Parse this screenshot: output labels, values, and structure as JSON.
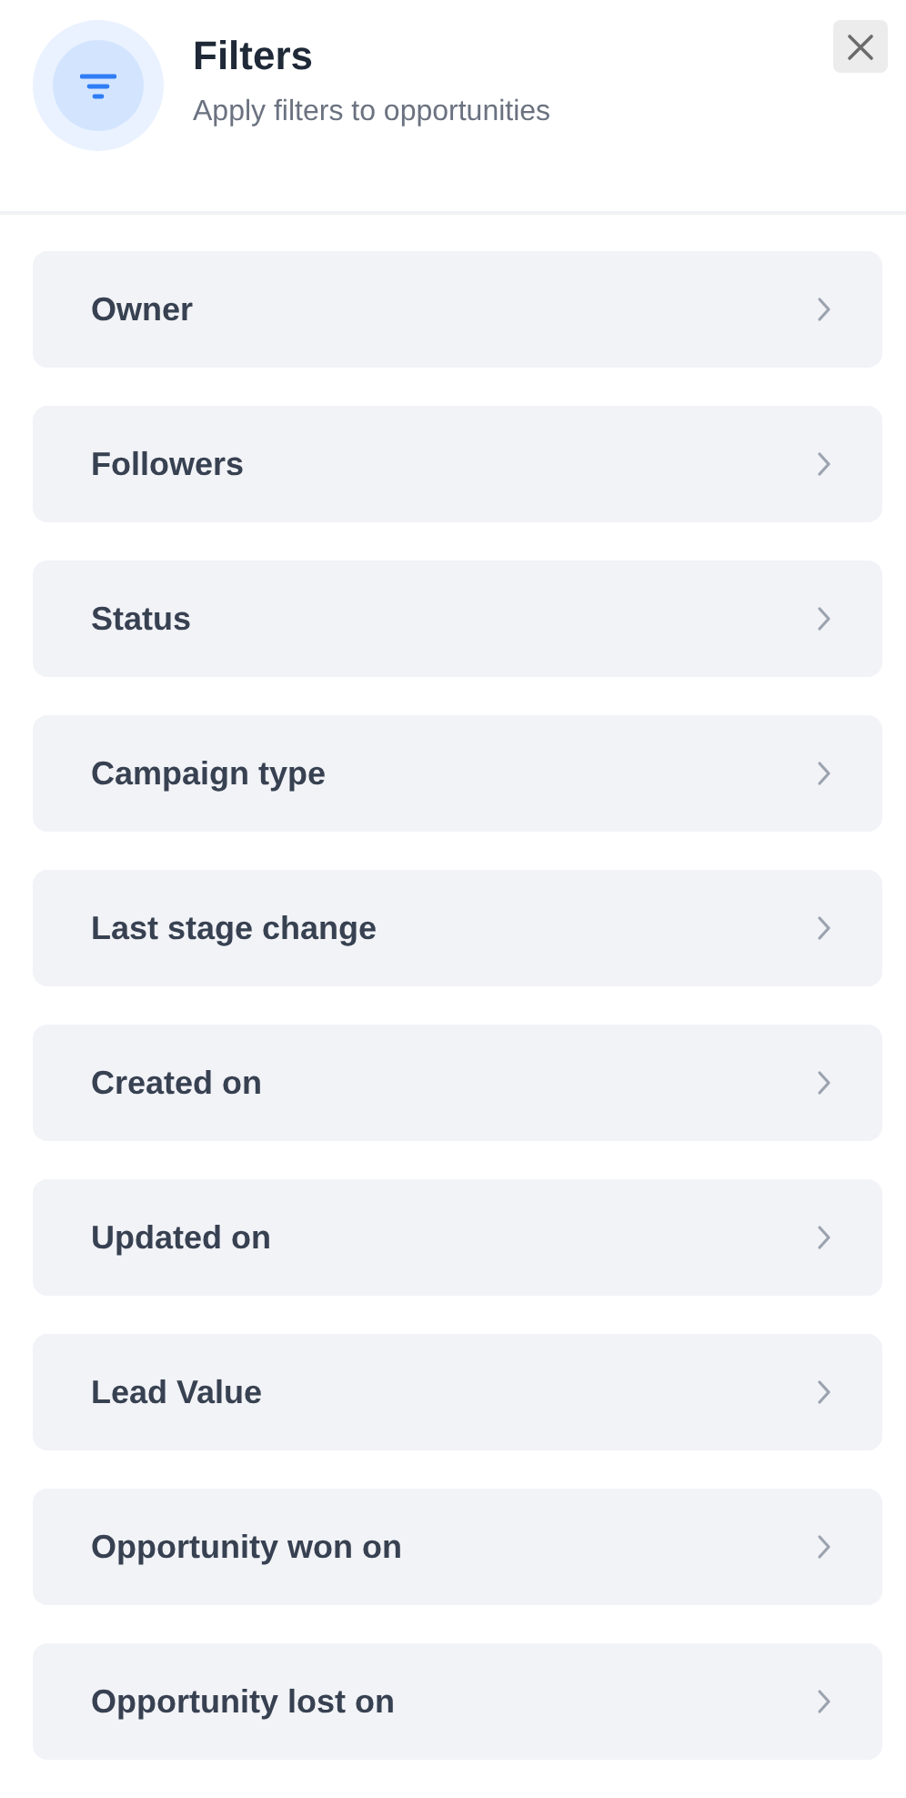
{
  "header": {
    "title": "Filters",
    "subtitle": "Apply filters to opportunities"
  },
  "filters": [
    {
      "label": "Owner"
    },
    {
      "label": "Followers"
    },
    {
      "label": "Status"
    },
    {
      "label": "Campaign type"
    },
    {
      "label": "Last stage change"
    },
    {
      "label": "Created on"
    },
    {
      "label": "Updated on"
    },
    {
      "label": "Lead Value"
    },
    {
      "label": "Opportunity won on"
    },
    {
      "label": "Opportunity lost on"
    }
  ]
}
